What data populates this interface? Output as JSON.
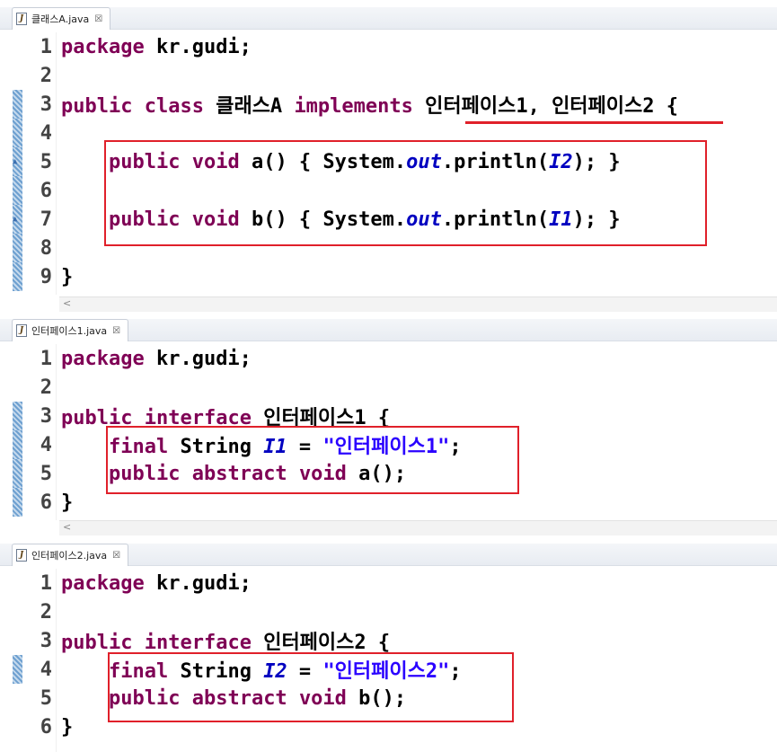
{
  "editors": [
    {
      "tab": "클래스A.java",
      "lines": [
        {
          "n": "1",
          "tokens": [
            {
              "t": "package",
              "c": "kw"
            },
            {
              "t": " kr.gudi;"
            }
          ]
        },
        {
          "n": "2",
          "tokens": []
        },
        {
          "n": "3",
          "tokens": [
            {
              "t": "public",
              "c": "kw"
            },
            {
              "t": " "
            },
            {
              "t": "class",
              "c": "kw"
            },
            {
              "t": " 클래스A "
            },
            {
              "t": "implements",
              "c": "kw"
            },
            {
              "t": " 인터페이스1, 인터페이스2 {"
            }
          ]
        },
        {
          "n": "4",
          "tokens": []
        },
        {
          "n": "5",
          "tokens": [
            {
              "t": "    "
            },
            {
              "t": "public",
              "c": "kw"
            },
            {
              "t": " "
            },
            {
              "t": "void",
              "c": "kw"
            },
            {
              "t": " a() { System."
            },
            {
              "t": "out",
              "c": "fld"
            },
            {
              "t": ".println("
            },
            {
              "t": "I2",
              "c": "fld"
            },
            {
              "t": "); }"
            }
          ]
        },
        {
          "n": "6",
          "tokens": []
        },
        {
          "n": "7",
          "tokens": [
            {
              "t": "    "
            },
            {
              "t": "public",
              "c": "kw"
            },
            {
              "t": " "
            },
            {
              "t": "void",
              "c": "kw"
            },
            {
              "t": " b() { System."
            },
            {
              "t": "out",
              "c": "fld"
            },
            {
              "t": ".println("
            },
            {
              "t": "I1",
              "c": "fld"
            },
            {
              "t": "); }"
            }
          ]
        },
        {
          "n": "8",
          "tokens": []
        },
        {
          "n": "9",
          "tokens": [
            {
              "t": "}"
            }
          ]
        }
      ],
      "scroll_glyph": "<"
    },
    {
      "tab": "인터페이스1.java",
      "lines": [
        {
          "n": "1",
          "tokens": [
            {
              "t": "package",
              "c": "kw"
            },
            {
              "t": " kr.gudi;"
            }
          ]
        },
        {
          "n": "2",
          "tokens": []
        },
        {
          "n": "3",
          "tokens": [
            {
              "t": "public",
              "c": "kw"
            },
            {
              "t": " "
            },
            {
              "t": "interface",
              "c": "kw"
            },
            {
              "t": " 인터페이스1 {"
            }
          ]
        },
        {
          "n": "4",
          "tokens": [
            {
              "t": "    "
            },
            {
              "t": "final",
              "c": "kw"
            },
            {
              "t": " String "
            },
            {
              "t": "I1",
              "c": "fld"
            },
            {
              "t": " = "
            },
            {
              "t": "\"인터페이스1\"",
              "c": "str"
            },
            {
              "t": ";"
            }
          ]
        },
        {
          "n": "5",
          "tokens": [
            {
              "t": "    "
            },
            {
              "t": "public",
              "c": "kw"
            },
            {
              "t": " "
            },
            {
              "t": "abstract",
              "c": "kw"
            },
            {
              "t": " "
            },
            {
              "t": "void",
              "c": "kw"
            },
            {
              "t": " a();"
            }
          ]
        },
        {
          "n": "6",
          "tokens": [
            {
              "t": "}"
            }
          ]
        }
      ],
      "scroll_glyph": "<"
    },
    {
      "tab": "인터페이스2.java",
      "lines": [
        {
          "n": "1",
          "tokens": [
            {
              "t": "package",
              "c": "kw"
            },
            {
              "t": " kr.gudi;"
            }
          ]
        },
        {
          "n": "2",
          "tokens": []
        },
        {
          "n": "3",
          "tokens": [
            {
              "t": "public",
              "c": "kw"
            },
            {
              "t": " "
            },
            {
              "t": "interface",
              "c": "kw"
            },
            {
              "t": " 인터페이스2 {"
            }
          ]
        },
        {
          "n": "4",
          "tokens": [
            {
              "t": "    "
            },
            {
              "t": "final",
              "c": "kw"
            },
            {
              "t": " String "
            },
            {
              "t": "I2",
              "c": "fld"
            },
            {
              "t": " = "
            },
            {
              "t": "\"인터페이스2\"",
              "c": "str"
            },
            {
              "t": ";"
            }
          ]
        },
        {
          "n": "5",
          "tokens": [
            {
              "t": "    "
            },
            {
              "t": "public",
              "c": "kw"
            },
            {
              "t": " "
            },
            {
              "t": "abstract",
              "c": "kw"
            },
            {
              "t": " "
            },
            {
              "t": "void",
              "c": "kw"
            },
            {
              "t": " b();"
            }
          ]
        },
        {
          "n": "6",
          "tokens": [
            {
              "t": "}"
            }
          ]
        }
      ],
      "scroll_glyph": ""
    }
  ],
  "colors": {
    "keyword": "#7f0055",
    "field": "#0000c0",
    "string": "#2a00ff",
    "annotation_red": "#e0202a"
  }
}
